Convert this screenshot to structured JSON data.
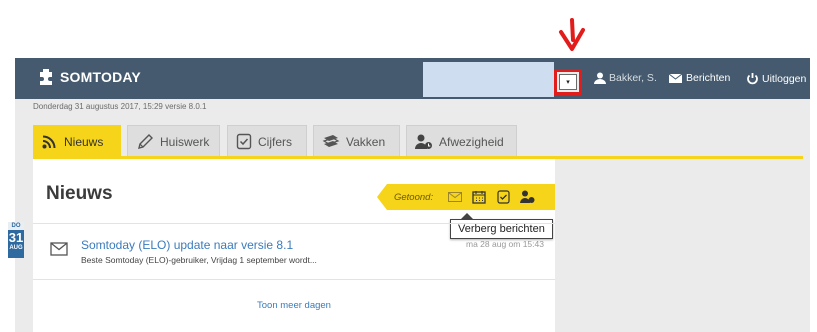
{
  "header": {
    "logo_text": "SOMTODAY",
    "user_name": "Bakker, S.",
    "messages_label": "Berichten",
    "logout_label": "Uitloggen",
    "dropdown_icon": "dropdown-toggle-icon"
  },
  "subheader": {
    "date_version": "Donderdag 31 augustus 2017, 15:29 versie 8.0.1"
  },
  "tabs": [
    {
      "label": "Nieuws",
      "icon": "rss-icon",
      "active": true
    },
    {
      "label": "Huiswerk",
      "icon": "pencil-icon",
      "active": false
    },
    {
      "label": "Cijfers",
      "icon": "check-document-icon",
      "active": false
    },
    {
      "label": "Vakken",
      "icon": "books-icon",
      "active": false
    },
    {
      "label": "Afwezigheid",
      "icon": "user-absent-icon",
      "active": false
    }
  ],
  "panel": {
    "title": "Nieuws",
    "filter_label": "Getoond:",
    "filter_icons": [
      "envelope-icon",
      "calendar-icon",
      "check-document-icon",
      "user-absent-icon"
    ],
    "tooltip": "Verberg berichten"
  },
  "date_marker": {
    "weekday": "DO",
    "day": "31",
    "month": "AUG"
  },
  "news_items": [
    {
      "title": "Somtoday (ELO) update naar versie 8.1",
      "snippet": "Beste Somtoday (ELO)-gebruiker, Vrijdag 1 september wordt...",
      "date": "ma 28 aug om 15:43"
    }
  ],
  "more_label": "Toon meer dagen",
  "colors": {
    "header_bg": "#455a6e",
    "accent_yellow": "#f6d41a",
    "link_blue": "#3b7bbd",
    "annotation_red": "#e21b1b"
  }
}
